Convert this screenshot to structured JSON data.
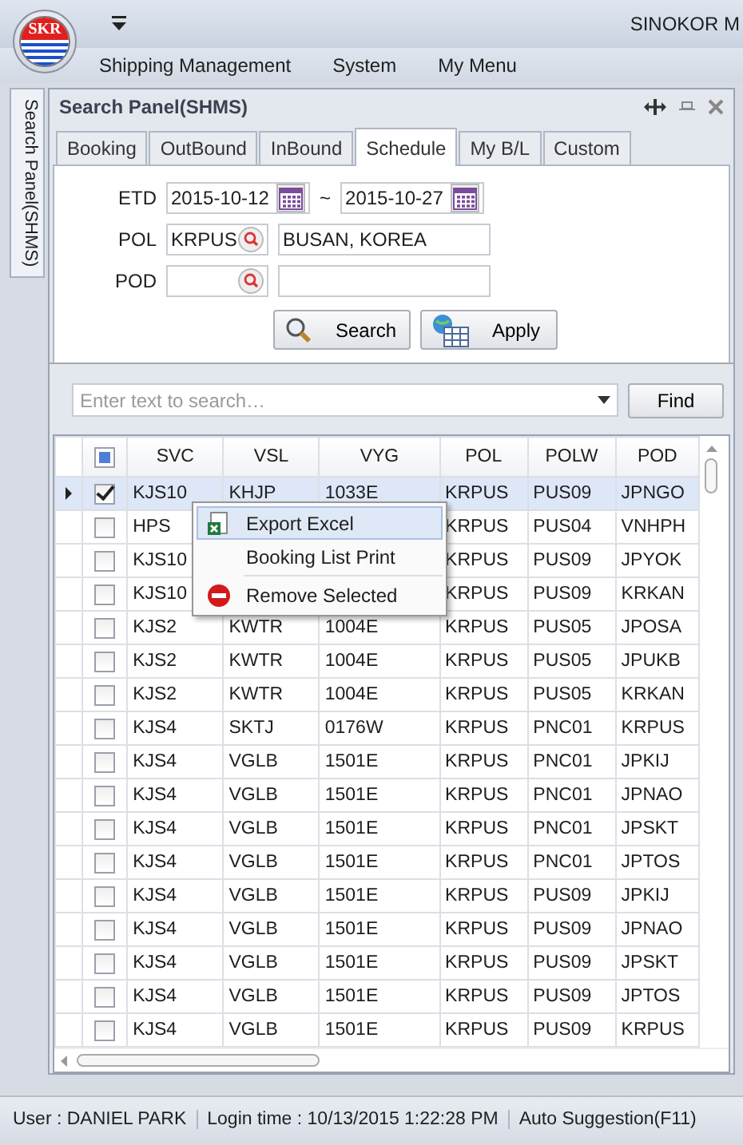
{
  "app": {
    "logo": "SKR",
    "title": "SINOKOR M"
  },
  "menu": [
    "Shipping Management",
    "System",
    "My Menu"
  ],
  "side_tab": "Search Panel(SHMS)",
  "panel": {
    "title": "Search Panel(SHMS)"
  },
  "tabs": [
    {
      "label": "Booking",
      "selected": false
    },
    {
      "label": "OutBound",
      "selected": false
    },
    {
      "label": "InBound",
      "selected": false
    },
    {
      "label": "Schedule",
      "selected": true
    },
    {
      "label": "My B/L",
      "selected": false
    },
    {
      "label": "Custom",
      "selected": false
    }
  ],
  "form": {
    "etd_label": "ETD",
    "etd_from": "2015-10-12",
    "separator": "~",
    "etd_to": "2015-10-27",
    "pol_label": "POL",
    "pol_code": "KRPUS",
    "pol_name": "BUSAN, KOREA",
    "pod_label": "POD"
  },
  "buttons": [
    {
      "label": "Search",
      "kind": "search"
    },
    {
      "label": "Apply",
      "kind": "apply"
    }
  ],
  "find": {
    "placeholder": "Enter text to search…",
    "button": "Find"
  },
  "grid": {
    "header_checked": true,
    "columns": [
      "SVC",
      "VSL",
      "VYG",
      "POL",
      "POLW",
      "POD"
    ],
    "rows": [
      {
        "selected": true,
        "checked": true,
        "cells": [
          "KJS10",
          "KHJP",
          "1033E",
          "KRPUS",
          "PUS09",
          "JPNGO"
        ]
      },
      {
        "selected": false,
        "checked": false,
        "cells": [
          "HPS",
          null,
          null,
          "KRPUS",
          "PUS04",
          "VNHPH"
        ]
      },
      {
        "selected": false,
        "checked": false,
        "cells": [
          "KJS10",
          null,
          null,
          "KRPUS",
          "PUS09",
          "JPYOK"
        ]
      },
      {
        "selected": false,
        "checked": false,
        "cells": [
          "KJS10",
          null,
          null,
          "KRPUS",
          "PUS09",
          "KRKAN"
        ]
      },
      {
        "selected": false,
        "checked": false,
        "cells": [
          "KJS2",
          "KWTR",
          "1004E",
          "KRPUS",
          "PUS05",
          "JPOSA"
        ]
      },
      {
        "selected": false,
        "checked": false,
        "cells": [
          "KJS2",
          "KWTR",
          "1004E",
          "KRPUS",
          "PUS05",
          "JPUKB"
        ]
      },
      {
        "selected": false,
        "checked": false,
        "cells": [
          "KJS2",
          "KWTR",
          "1004E",
          "KRPUS",
          "PUS05",
          "KRKAN"
        ]
      },
      {
        "selected": false,
        "checked": false,
        "cells": [
          "KJS4",
          "SKTJ",
          "0176W",
          "KRPUS",
          "PNC01",
          "KRPUS"
        ]
      },
      {
        "selected": false,
        "checked": false,
        "cells": [
          "KJS4",
          "VGLB",
          "1501E",
          "KRPUS",
          "PNC01",
          "JPKIJ"
        ]
      },
      {
        "selected": false,
        "checked": false,
        "cells": [
          "KJS4",
          "VGLB",
          "1501E",
          "KRPUS",
          "PNC01",
          "JPNAO"
        ]
      },
      {
        "selected": false,
        "checked": false,
        "cells": [
          "KJS4",
          "VGLB",
          "1501E",
          "KRPUS",
          "PNC01",
          "JPSKT"
        ]
      },
      {
        "selected": false,
        "checked": false,
        "cells": [
          "KJS4",
          "VGLB",
          "1501E",
          "KRPUS",
          "PNC01",
          "JPTOS"
        ]
      },
      {
        "selected": false,
        "checked": false,
        "cells": [
          "KJS4",
          "VGLB",
          "1501E",
          "KRPUS",
          "PUS09",
          "JPKIJ"
        ]
      },
      {
        "selected": false,
        "checked": false,
        "cells": [
          "KJS4",
          "VGLB",
          "1501E",
          "KRPUS",
          "PUS09",
          "JPNAO"
        ]
      },
      {
        "selected": false,
        "checked": false,
        "cells": [
          "KJS4",
          "VGLB",
          "1501E",
          "KRPUS",
          "PUS09",
          "JPSKT"
        ]
      },
      {
        "selected": false,
        "checked": false,
        "cells": [
          "KJS4",
          "VGLB",
          "1501E",
          "KRPUS",
          "PUS09",
          "JPTOS"
        ]
      },
      {
        "selected": false,
        "checked": false,
        "cells": [
          "KJS4",
          "VGLB",
          "1501E",
          "KRPUS",
          "PUS09",
          "KRPUS"
        ]
      }
    ]
  },
  "context_menu": [
    {
      "label": "Export Excel",
      "kind": "excel",
      "selected": true
    },
    {
      "label": "Booking List Print",
      "kind": "none",
      "selected": false
    },
    {
      "label": "Remove Selected",
      "kind": "remove",
      "selected": false
    }
  ],
  "status_bar": [
    "User : DANIEL PARK",
    "Login time : 10/13/2015 1:22:28 PM",
    "Auto Suggestion(F11)"
  ]
}
